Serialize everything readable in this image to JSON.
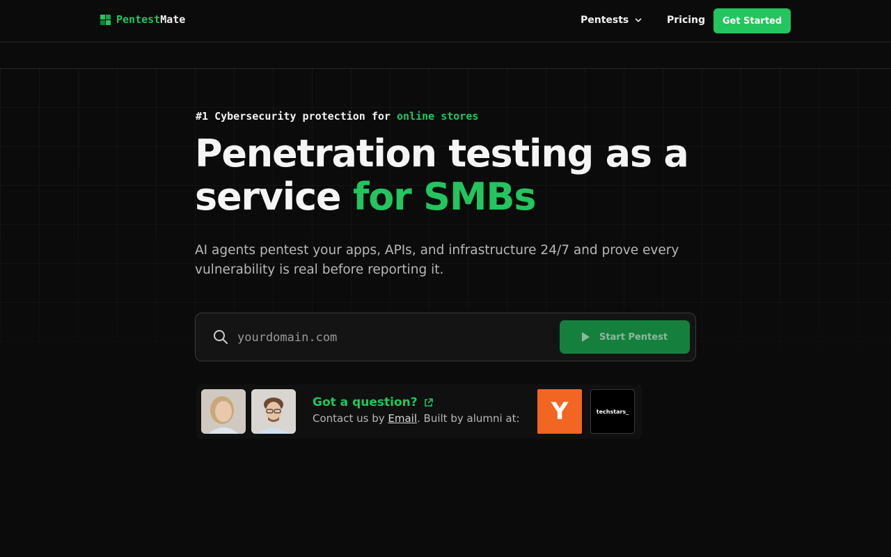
{
  "header": {
    "logo_part1": "Pentest",
    "logo_part2": "Mate",
    "nav_pentests": "Pentests",
    "nav_pricing": "Pricing",
    "cta": "Get Started"
  },
  "hero": {
    "eyebrow_prefix": "#1 Cybersecurity protection for ",
    "eyebrow_highlight": "online stores",
    "title_part1": "Penetration testing as a service ",
    "title_highlight": "for SMBs",
    "subtitle": "AI agents pentest your apps, APIs, and infrastructure 24/7 and prove every vulnerability is real before reporting it."
  },
  "search": {
    "placeholder": "yourdomain.com",
    "button_label": "Start Pentest"
  },
  "contact": {
    "title": "Got a question?",
    "line_prefix": "Contact us by ",
    "email_label": "Email",
    "line_suffix": ". Built by alumni at:",
    "yc_letter": "Y",
    "techstars_label": "techstars_"
  },
  "next_section": {
    "heading_partial": ""
  },
  "colors": {
    "accent": "#22c55e",
    "background": "#0b0b0b",
    "yc_orange": "#f26522"
  },
  "icons": [
    "grid-logo-icon",
    "chevron-down-icon",
    "search-icon",
    "play-icon",
    "external-link-icon"
  ]
}
